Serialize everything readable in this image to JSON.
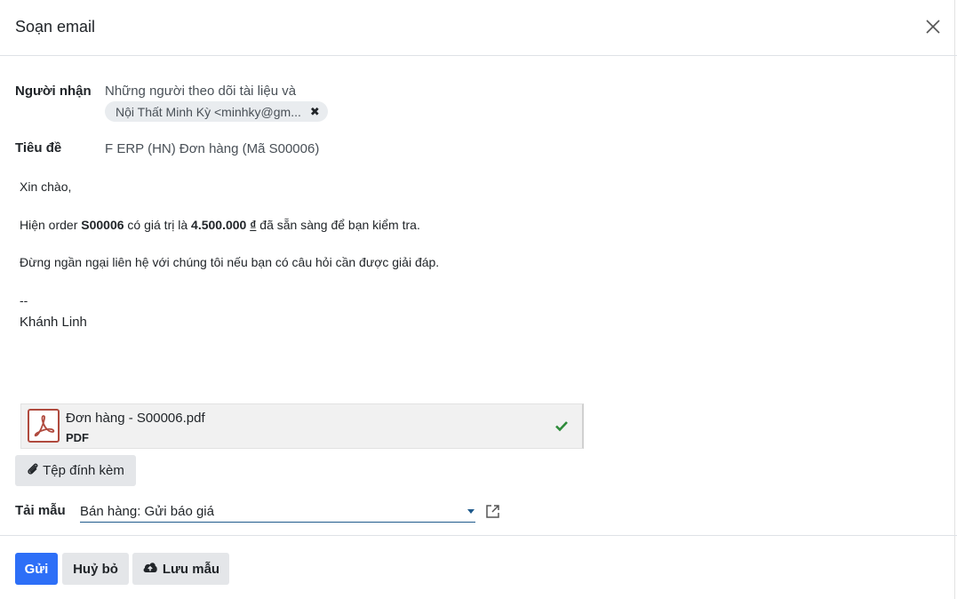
{
  "modal": {
    "title": "Soạn email",
    "close_icon": "close-icon"
  },
  "recipients": {
    "label": "Người nhận",
    "followers_text": "Những người theo dõi tài liệu và",
    "tags": [
      {
        "text": "Nội Thất Minh Kỳ <minhky@gm...",
        "remove_icon": "remove-x-icon"
      }
    ]
  },
  "subject": {
    "label": "Tiêu đề",
    "value": "F ERP (HN) Đơn hàng (Mã S00006)"
  },
  "body": {
    "greeting": "Xin chào,",
    "line1_prefix": "Hiện order ",
    "order_ref": "S00006",
    "line1_middle": " có giá trị là ",
    "amount": "4.500.000 ",
    "currency": "₫",
    "line1_suffix": " đã sẵn sàng để bạn kiểm tra.",
    "line2": "Đừng ngần ngại liên hệ với chúng tôi nếu bạn có câu hỏi cần được giải đáp.",
    "signature_sep": "--",
    "signature_name": "Khánh Linh"
  },
  "attachment": {
    "name": "Đơn hàng - S00006.pdf",
    "type": "PDF",
    "icon": "pdf-file-icon",
    "status_icon": "check-icon",
    "status_color": "#2e8b3a"
  },
  "attach_button": {
    "label": "Tệp đính kèm",
    "icon": "paperclip-icon"
  },
  "template": {
    "label": "Tải mẫu",
    "selected": "Bán hàng: Gửi báo giá",
    "external_icon": "external-link-icon"
  },
  "footer": {
    "send_label": "Gửi",
    "cancel_label": "Huỷ bỏ",
    "save_template_label": "Lưu mẫu",
    "save_icon": "cloud-upload-icon",
    "accent_color": "#2d6ff7"
  }
}
